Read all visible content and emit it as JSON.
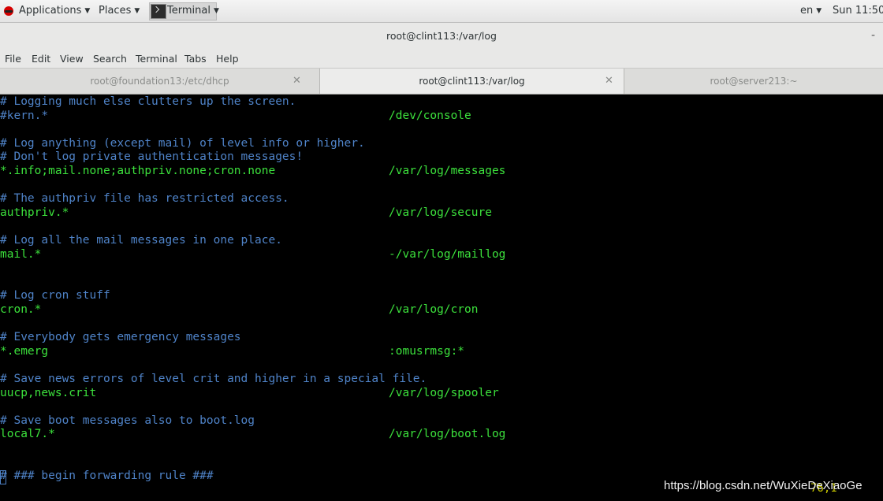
{
  "topbar": {
    "applications": "Applications",
    "places": "Places",
    "terminal": "Terminal",
    "lang": "en",
    "clock": "Sun 11:50"
  },
  "window": {
    "title": "root@clint113:/var/log",
    "minimize": "-"
  },
  "menu": [
    "File",
    "Edit",
    "View",
    "Search",
    "Terminal",
    "Tabs",
    "Help"
  ],
  "tabs": [
    {
      "label": "root@foundation13:/etc/dhcp",
      "active": false
    },
    {
      "label": "root@clint113:/var/log",
      "active": true
    },
    {
      "label": "root@server213:~",
      "active": false
    }
  ],
  "terminal": {
    "lines": [
      {
        "left": "# Logging much else clutters up the screen.",
        "right": "",
        "type": "comment"
      },
      {
        "left": "#kern.*",
        "right": "/dev/console",
        "type": "comment"
      },
      {
        "left": "",
        "right": "",
        "type": "blank"
      },
      {
        "left": "# Log anything (except mail) of level info or higher.",
        "right": "",
        "type": "comment"
      },
      {
        "left": "# Don't log private authentication messages!",
        "right": "",
        "type": "comment"
      },
      {
        "left": "*.info;mail.none;authpriv.none;cron.none",
        "right": "/var/log/messages",
        "type": "code"
      },
      {
        "left": "",
        "right": "",
        "type": "blank"
      },
      {
        "left": "# The authpriv file has restricted access.",
        "right": "",
        "type": "comment"
      },
      {
        "left": "authpriv.*",
        "right": "/var/log/secure",
        "type": "code"
      },
      {
        "left": "",
        "right": "",
        "type": "blank"
      },
      {
        "left": "# Log all the mail messages in one place.",
        "right": "",
        "type": "comment"
      },
      {
        "left": "mail.*",
        "right": "-/var/log/maillog",
        "type": "code"
      },
      {
        "left": "",
        "right": "",
        "type": "blank"
      },
      {
        "left": "",
        "right": "",
        "type": "blank"
      },
      {
        "left": "# Log cron stuff",
        "right": "",
        "type": "comment"
      },
      {
        "left": "cron.*",
        "right": "/var/log/cron",
        "type": "code"
      },
      {
        "left": "",
        "right": "",
        "type": "blank"
      },
      {
        "left": "# Everybody gets emergency messages",
        "right": "",
        "type": "comment"
      },
      {
        "left": "*.emerg",
        "right": ":omusrmsg:*",
        "type": "code"
      },
      {
        "left": "",
        "right": "",
        "type": "blank"
      },
      {
        "left": "# Save news errors of level crit and higher in a special file.",
        "right": "",
        "type": "comment"
      },
      {
        "left": "uucp,news.crit",
        "right": "/var/log/spooler",
        "type": "code"
      },
      {
        "left": "",
        "right": "",
        "type": "blank"
      },
      {
        "left": "# Save boot messages also to boot.log",
        "right": "",
        "type": "comment"
      },
      {
        "left": "local7.*",
        "right": "/var/log/boot.log",
        "type": "code"
      },
      {
        "left": "",
        "right": "",
        "type": "blank"
      },
      {
        "left": "",
        "right": "",
        "type": "blank"
      },
      {
        "left": "# ### begin forwarding rule ###",
        "right": "",
        "type": "comment"
      }
    ],
    "position": "76,1"
  },
  "watermark": "https://blog.csdn.net/WuXieDeXiaoGe"
}
